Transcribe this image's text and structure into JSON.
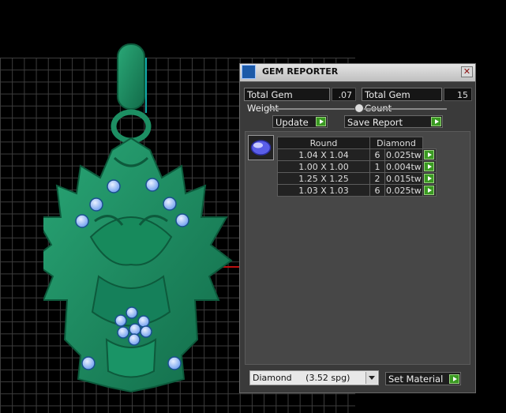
{
  "panel": {
    "title": "GEM REPORTER",
    "close_glyph": "✕",
    "total_weight": {
      "label": "Total Gem Weight",
      "value": ".07"
    },
    "total_count": {
      "label": "Total Gem Count",
      "value": "15"
    },
    "update_label": "Update",
    "save_report_label": "Save Report",
    "table": {
      "shape_header": "Round",
      "material_header": "Diamond",
      "rows": [
        {
          "size": "1.04 X 1.04",
          "count": "6",
          "weight": "0.025tw"
        },
        {
          "size": "1.00 X 1.00",
          "count": "1",
          "weight": "0.004tw"
        },
        {
          "size": "1.25 X 1.25",
          "count": "2",
          "weight": "0.015tw"
        },
        {
          "size": "1.03 X 1.03",
          "count": "6",
          "weight": "0.025tw"
        }
      ]
    },
    "material_select_value": "Diamond     (3.52 spg)",
    "set_material_label": "Set Material"
  },
  "colors": {
    "model": "#1f8a62",
    "gem": "#8fb8ff",
    "go_button": "#3a9a22"
  },
  "icons": [
    "gem-reporter-icon",
    "close-icon",
    "go-arrow-icon",
    "gem-thumbnail-icon",
    "dropdown-arrow-icon"
  ]
}
